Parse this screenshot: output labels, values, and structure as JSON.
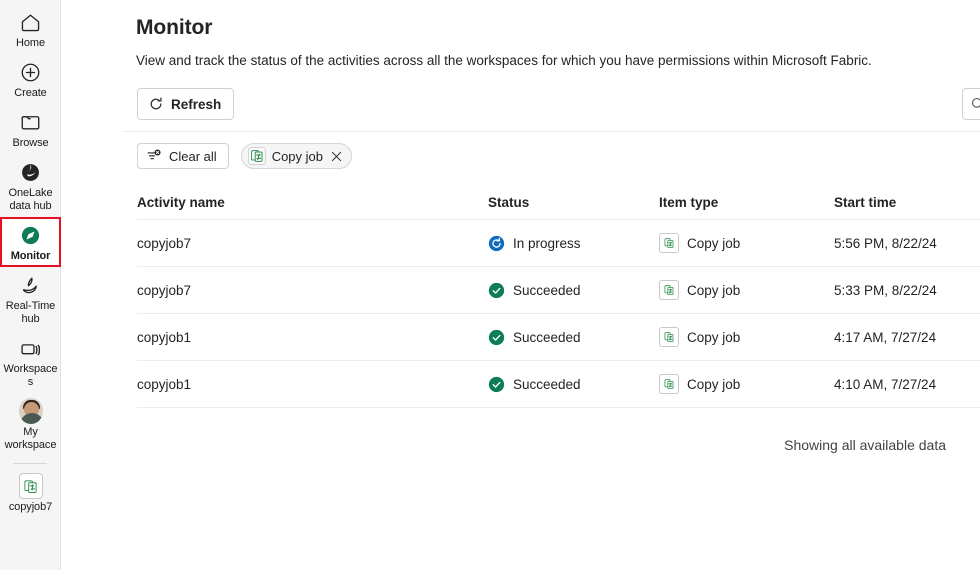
{
  "sidebar": {
    "items": [
      {
        "label": "Home",
        "icon": "home-icon",
        "selected": false
      },
      {
        "label": "Create",
        "icon": "plus-circle-icon",
        "selected": false
      },
      {
        "label": "Browse",
        "icon": "folder-icon",
        "selected": false
      },
      {
        "label": "OneLake data hub",
        "icon": "onelake-icon",
        "selected": false
      },
      {
        "label": "Monitor",
        "icon": "monitor-compass-icon",
        "selected": true
      },
      {
        "label": "Real-Time hub",
        "icon": "real-time-hub-icon",
        "selected": false
      },
      {
        "label": "Workspaces",
        "icon": "workspaces-icon",
        "selected": false
      },
      {
        "label": "My workspace",
        "icon": "avatar",
        "selected": false
      },
      {
        "label": "copyjob7",
        "icon": "copy-job-icon",
        "selected": false
      }
    ],
    "selected_outline_color": "#e81123"
  },
  "header": {
    "title": "Monitor",
    "subtitle": "View and track the status of the activities across all the workspaces for which you have permissions within Microsoft Fabric."
  },
  "toolbar": {
    "refresh_label": "Refresh",
    "refresh_icon": "refresh-icon",
    "search_icon": "search-icon"
  },
  "filters": {
    "clear_all_label": "Clear all",
    "clear_all_icon": "clear-filter-icon",
    "chips": [
      {
        "label": "Copy job",
        "icon": "copy-job-icon",
        "close_icon": "close-icon"
      }
    ]
  },
  "table": {
    "columns": [
      "Activity name",
      "Status",
      "Item type",
      "Start time"
    ],
    "rows": [
      {
        "activity_name": "copyjob7",
        "status": "In progress",
        "status_kind": "in-progress",
        "item_type": "Copy job",
        "start_time": "5:56 PM, 8/22/24"
      },
      {
        "activity_name": "copyjob7",
        "status": "Succeeded",
        "status_kind": "succeeded",
        "item_type": "Copy job",
        "start_time": "5:33 PM, 8/22/24"
      },
      {
        "activity_name": "copyjob1",
        "status": "Succeeded",
        "status_kind": "succeeded",
        "item_type": "Copy job",
        "start_time": "4:17 AM, 7/27/24"
      },
      {
        "activity_name": "copyjob1",
        "status": "Succeeded",
        "status_kind": "succeeded",
        "item_type": "Copy job",
        "start_time": "4:10 AM, 7/27/24"
      }
    ]
  },
  "footer": {
    "note": "Showing all available data"
  },
  "colors": {
    "in_progress": "#0f6cbd",
    "succeeded": "#0e7c5a",
    "copy_job_green": "#2a8c4a",
    "selection_red": "#e81123"
  }
}
